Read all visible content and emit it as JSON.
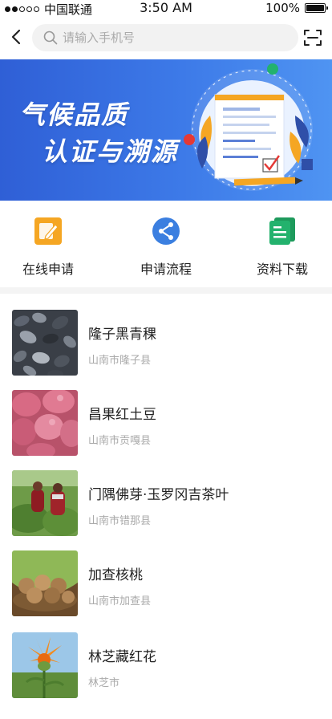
{
  "status_bar": {
    "carrier": "中国联通",
    "time": "3:50 AM",
    "battery": "100%"
  },
  "search": {
    "placeholder": "请输入手机号"
  },
  "banner": {
    "title_line1": "气候品质",
    "title_line2": "认证与溯源"
  },
  "actions": [
    {
      "label": "在线申请",
      "icon": "edit-icon",
      "color": "#f5a623"
    },
    {
      "label": "申请流程",
      "icon": "process-icon",
      "color": "#3b7fe0"
    },
    {
      "label": "资料下载",
      "icon": "document-icon",
      "color": "#23b26d"
    }
  ],
  "products": [
    {
      "name": "隆子黑青稞",
      "location": "山南市隆子县",
      "image": "black-barley-photo"
    },
    {
      "name": "昌果红土豆",
      "location": "山南市贡嘎县",
      "image": "red-potato-photo"
    },
    {
      "name": "门隅佛芽·玉罗冈吉茶叶",
      "location": "山南市错那县",
      "image": "tea-picking-photo"
    },
    {
      "name": "加查核桃",
      "location": "山南市加查县",
      "image": "walnut-photo"
    },
    {
      "name": "林芝藏红花",
      "location": "林芝市",
      "image": "safflower-photo"
    }
  ]
}
